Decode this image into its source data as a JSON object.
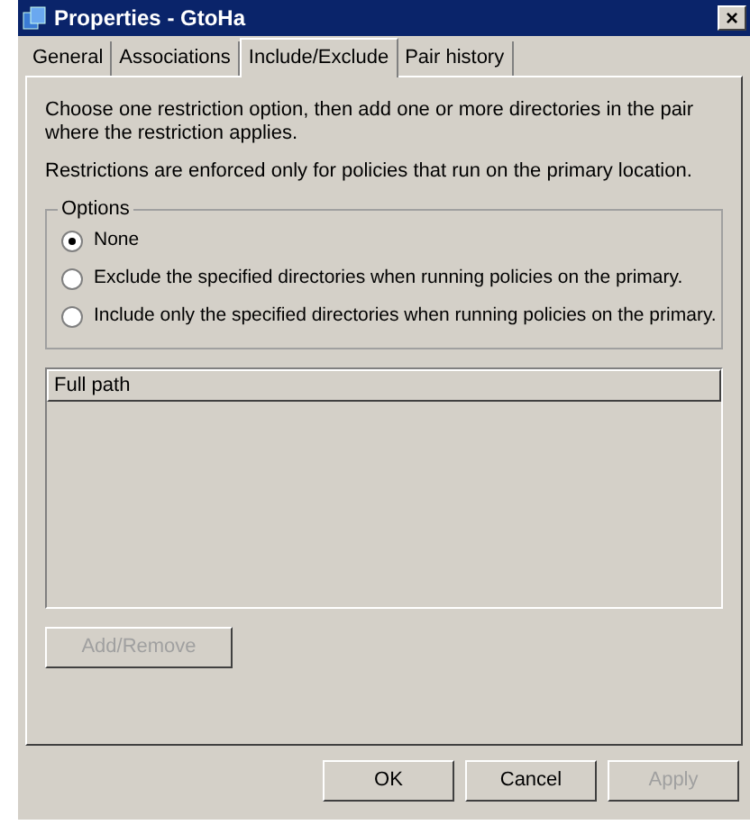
{
  "window": {
    "title": "Properties - GtoHa",
    "close": "×"
  },
  "tabs": [
    {
      "label": "General",
      "selected": false
    },
    {
      "label": "Associations",
      "selected": false
    },
    {
      "label": "Include/Exclude",
      "selected": true
    },
    {
      "label": "Pair history",
      "selected": false
    }
  ],
  "intro": [
    "Choose one restriction option, then add one or more directories in the pair where the restriction applies.",
    "Restrictions are enforced only for policies that run on the primary location."
  ],
  "options": {
    "title": "Options",
    "items": [
      {
        "label": "None",
        "selected": true
      },
      {
        "label": "Exclude the specified directories when running policies on the primary.",
        "selected": false
      },
      {
        "label": "Include only the specified directories when running policies on the primary.",
        "selected": false
      }
    ]
  },
  "list": {
    "columns": [
      "Full path"
    ]
  },
  "add_remove": {
    "label": "Add/Remove",
    "disabled": true
  },
  "buttons": [
    {
      "label": "OK",
      "disabled": false
    },
    {
      "label": "Cancel",
      "disabled": false
    },
    {
      "label": "Apply",
      "disabled": true
    }
  ]
}
